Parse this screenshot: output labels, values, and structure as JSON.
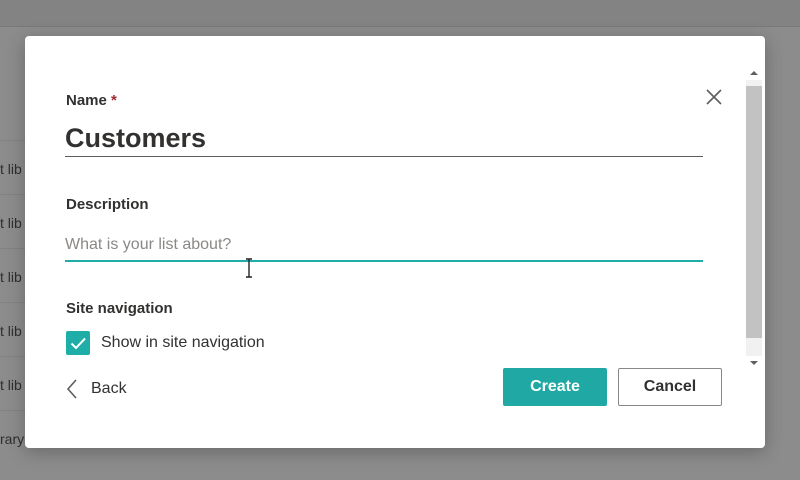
{
  "background": {
    "list_items": [
      "t lib",
      "t lib",
      "t lib",
      "t lib",
      "t lib",
      "rary"
    ]
  },
  "dialog": {
    "name_label": "Name",
    "required_marker": "*",
    "name_value": "Customers",
    "description_label": "Description",
    "description_placeholder": "What is your list about?",
    "site_navigation_label": "Site navigation",
    "show_in_nav_label": "Show in site navigation",
    "show_in_nav_checked": true,
    "back_label": "Back",
    "create_label": "Create",
    "cancel_label": "Cancel"
  },
  "icons": {
    "close": "close-icon",
    "back": "chevron-left-icon",
    "check": "checkmark-icon"
  },
  "colors": {
    "accent": "#1fa8a4",
    "focus_underline": "#1fada8",
    "required": "#a4262c",
    "overlay": "#8c8c8c"
  }
}
